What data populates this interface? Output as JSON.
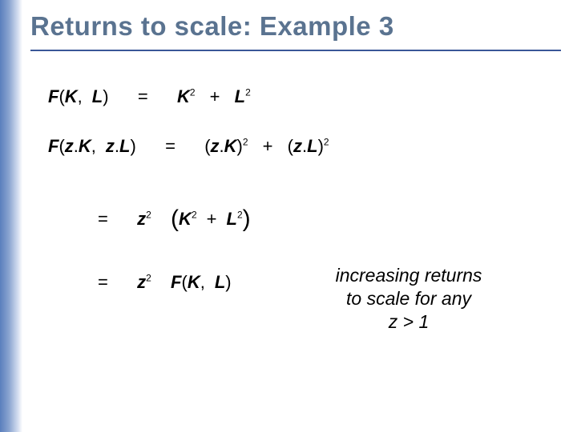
{
  "title": "Returns to scale:  Example 3",
  "eq1": {
    "lhs_F": "F",
    "lhs_open": "(",
    "lhs_K": "K",
    "lhs_comma": ",",
    "lhs_L": "L",
    "lhs_close": ")",
    "eq": "=",
    "rhs_K": "K",
    "rhs_K_exp": "2",
    "rhs_plus": "+",
    "rhs_L": "L",
    "rhs_L_exp": "2"
  },
  "eq2": {
    "lhs_F": "F",
    "lhs_open": "(",
    "lhs_zK_z": "z",
    "lhs_zK_dot": ".",
    "lhs_zK_K": "K",
    "lhs_comma": ",",
    "lhs_zL_z": "z",
    "lhs_zL_dot": ".",
    "lhs_zL_L": "L",
    "lhs_close": ")",
    "eq": "=",
    "rhs_open1": "(",
    "rhs_z1": "z",
    "rhs_dot1": ".",
    "rhs_K": "K",
    "rhs_close1": ")",
    "rhs_exp1": "2",
    "rhs_plus": "+",
    "rhs_open2": "(",
    "rhs_z2": "z",
    "rhs_dot2": ".",
    "rhs_L": "L",
    "rhs_close2": ")",
    "rhs_exp2": "2"
  },
  "eq3": {
    "eq": "=",
    "z": "z",
    "z_exp": "2",
    "lparen": "(",
    "K": "K",
    "K_exp": "2",
    "plus": "+",
    "L": "L",
    "L_exp": "2",
    "rparen": ")"
  },
  "eq4": {
    "eq": "=",
    "z": "z",
    "z_exp": "2",
    "F": "F",
    "open": "(",
    "K": "K",
    "comma": ",",
    "L": "L",
    "close": ")"
  },
  "caption": {
    "line1": "increasing returns",
    "line2": "to scale for any",
    "line3_z": "z",
    "line3_rest": " > 1"
  }
}
